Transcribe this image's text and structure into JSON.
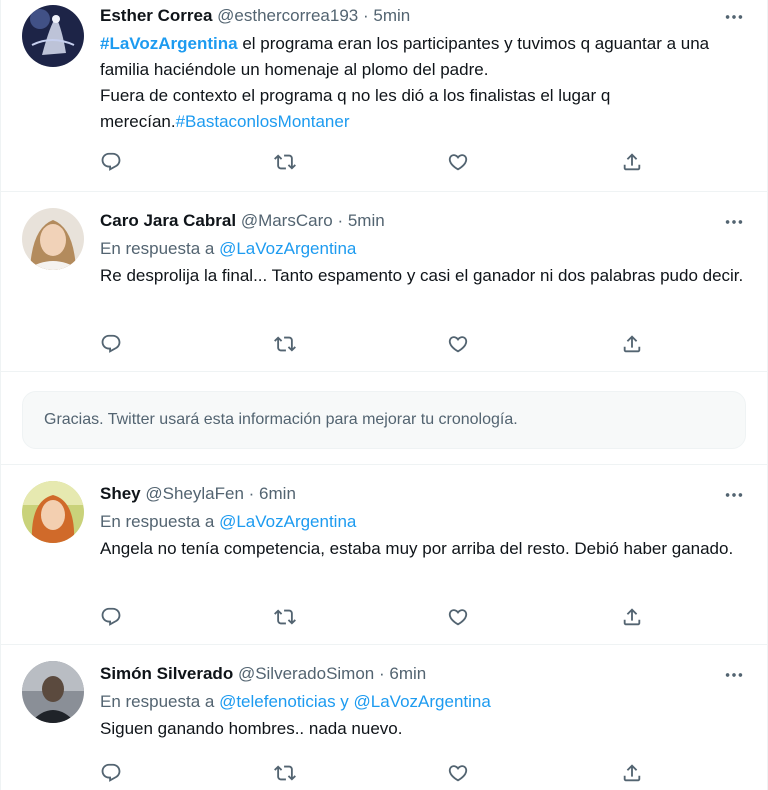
{
  "tweets": [
    {
      "name": "Esther Correa",
      "handle": "@esthercorrea193",
      "dot": "·",
      "time": "5min",
      "hashtag_start": "#LaVozArgentina",
      "text_1": " el programa eran los participantes y tuvimos q aguantar a una familia haciéndole un homenaje al plomo del padre.",
      "text_2": "Fuera de contexto el programa q no les dió a los finalistas el lugar q merecían.",
      "hashtag_end": "#BastaconlosMontaner"
    },
    {
      "name": "Caro Jara Cabral",
      "handle": "@MarsCaro",
      "dot": "·",
      "time": "5min",
      "reply_prefix": "En respuesta a ",
      "reply_mention": "@LaVozArgentina",
      "text": "Re desprolija la final... Tanto espamento y casi el ganador ni dos palabras pudo decir."
    },
    {
      "name": "Shey",
      "handle": "@SheylaFen",
      "dot": "·",
      "time": "6min",
      "reply_prefix": "En respuesta a ",
      "reply_mention": "@LaVozArgentina",
      "text": "Angela no tenía competencia, estaba muy por arriba del resto. Debió haber ganado."
    },
    {
      "name": "Simón Silverado",
      "handle": "@SilveradoSimon",
      "dot": "·",
      "time": "6min",
      "reply_prefix": "En respuesta a ",
      "reply_mention": "@telefenoticias y @LaVozArgentina",
      "text": "Siguen ganando hombres.. nada nuevo."
    }
  ],
  "notice": {
    "text": "Gracias. Twitter usará esta información para mejorar tu cronología."
  },
  "icons": {
    "reply": "reply-icon",
    "retweet": "retweet-icon",
    "like": "like-icon",
    "share": "share-icon",
    "more": "more-icon"
  },
  "colors": {
    "link": "#1d9bf0",
    "secondary_text": "#536471",
    "primary_text": "#0f1419",
    "divider": "#eff3f4"
  }
}
